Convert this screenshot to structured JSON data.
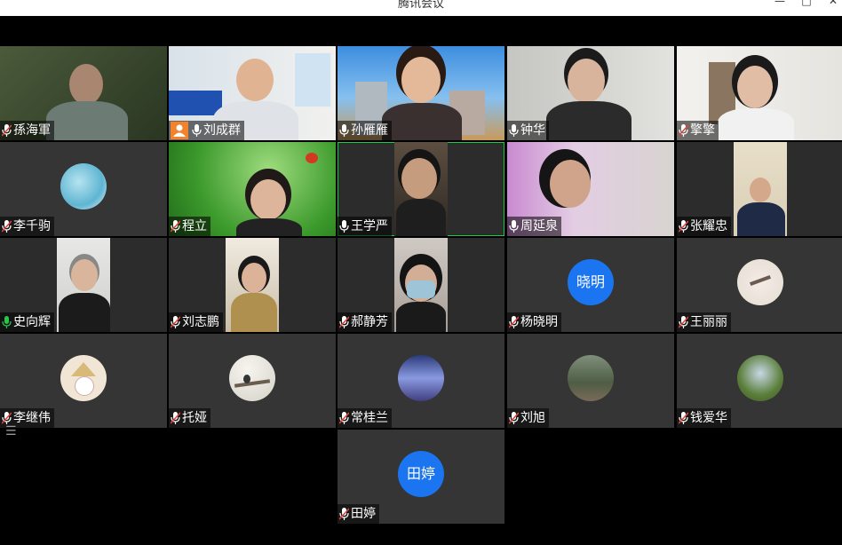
{
  "window": {
    "title": "腾讯会议",
    "minimize": "—",
    "maximize": "□",
    "close": "✕"
  },
  "participants": [
    {
      "name": "孫海軍",
      "mic": "muted"
    },
    {
      "name": "刘成群",
      "mic": "on",
      "host": true
    },
    {
      "name": "孙雁雁",
      "mic": "on"
    },
    {
      "name": "钟华",
      "mic": "on"
    },
    {
      "name": "擎擎",
      "mic": "muted"
    },
    {
      "name": "李千驹",
      "mic": "muted"
    },
    {
      "name": "程立",
      "mic": "muted"
    },
    {
      "name": "王学严",
      "mic": "on"
    },
    {
      "name": "周延泉",
      "mic": "on"
    },
    {
      "name": "张耀忠",
      "mic": "muted"
    },
    {
      "name": "史向辉",
      "mic": "speaking"
    },
    {
      "name": "刘志鹏",
      "mic": "muted"
    },
    {
      "name": "郝静芳",
      "mic": "muted"
    },
    {
      "name": "杨晓明",
      "mic": "muted",
      "avatar_text": "晓明"
    },
    {
      "name": "王丽丽",
      "mic": "muted"
    },
    {
      "name": "李继伟",
      "mic": "muted"
    },
    {
      "name": "托娅",
      "mic": "muted"
    },
    {
      "name": "常桂兰",
      "mic": "muted"
    },
    {
      "name": "刘旭",
      "mic": "muted"
    },
    {
      "name": "钱爱华",
      "mic": "muted"
    },
    {
      "name": "田婷",
      "mic": "muted",
      "avatar_text": "田婷"
    }
  ],
  "colors": {
    "avatar_blue": "#1b74f0",
    "speaking_green": "#29c44a",
    "host_orange": "#f2832b",
    "muted_red": "#e0453b"
  },
  "icons": {
    "participant_list": "list-icon"
  }
}
